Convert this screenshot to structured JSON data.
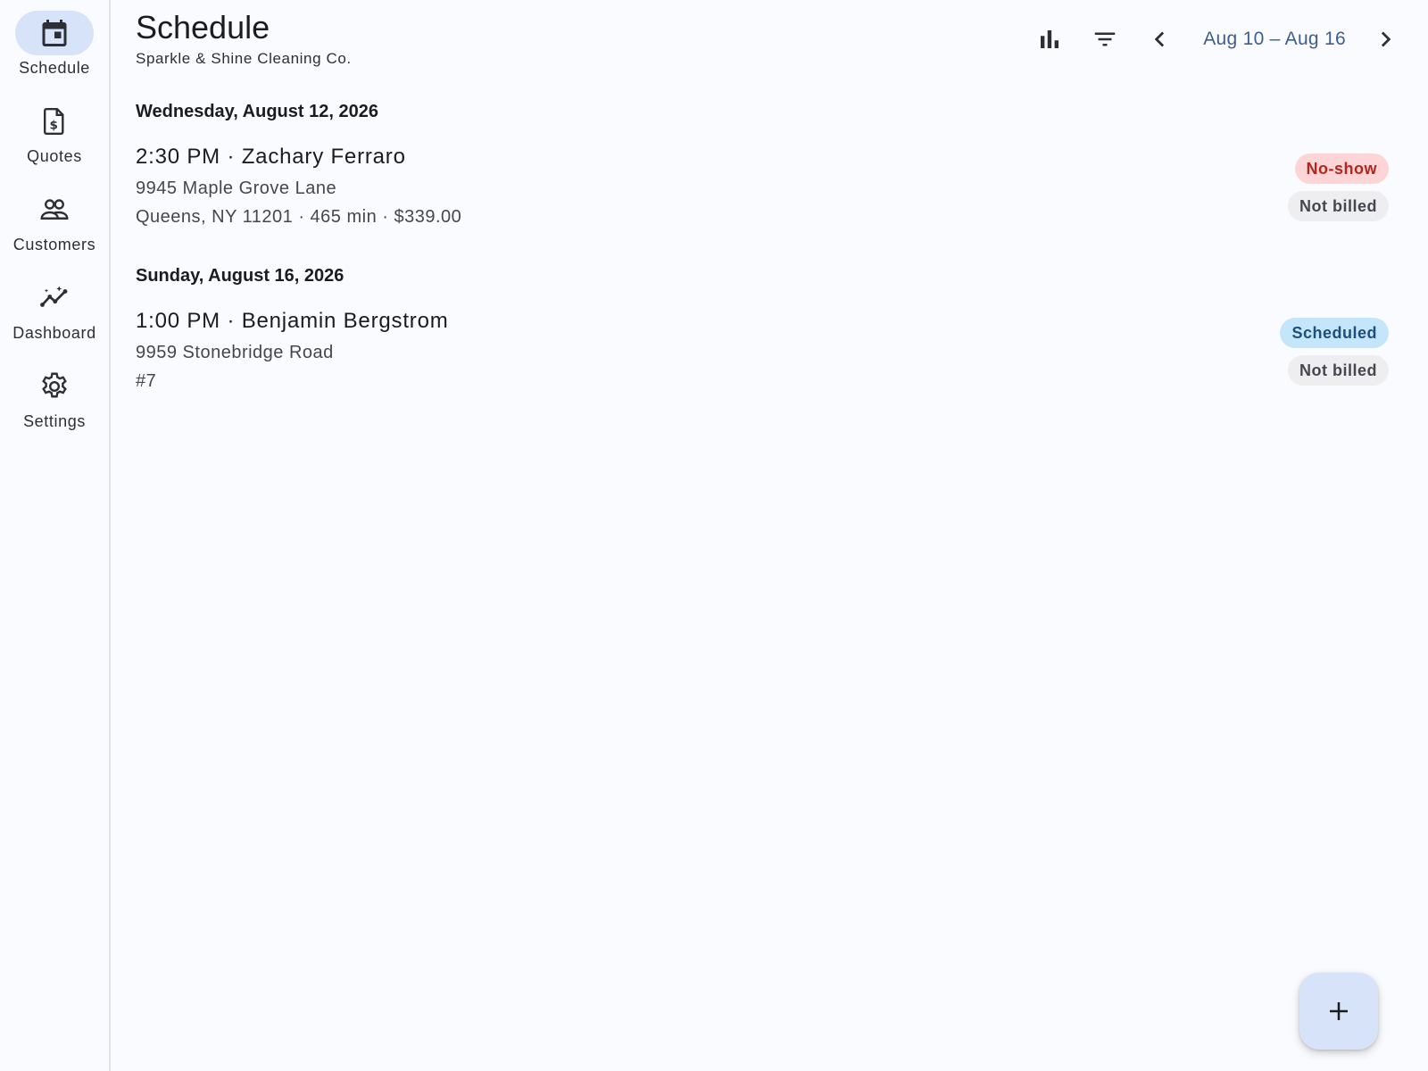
{
  "nav": {
    "items": [
      {
        "label": "Schedule",
        "icon": "calendar-icon",
        "active": true
      },
      {
        "label": "Quotes",
        "icon": "quote-document-icon",
        "active": false
      },
      {
        "label": "Customers",
        "icon": "people-icon",
        "active": false
      },
      {
        "label": "Dashboard",
        "icon": "insights-icon",
        "active": false
      },
      {
        "label": "Settings",
        "icon": "gear-icon",
        "active": false
      }
    ]
  },
  "header": {
    "title": "Schedule",
    "subtitle": "Sparkle & Shine Cleaning Co.",
    "week_range": "Aug 10 – Aug 16"
  },
  "days": [
    {
      "heading": "Wednesday, August 12, 2026",
      "appointments": [
        {
          "title": "2:30 PM · Zachary Ferraro",
          "line1": "9945 Maple Grove Lane",
          "line2": "Queens, NY 11201 · 465 min · $339.00",
          "status": "No-show",
          "billing": "Not billed"
        }
      ]
    },
    {
      "heading": "Sunday, August 16, 2026",
      "appointments": [
        {
          "title": "1:00 PM · Benjamin Bergstrom",
          "line1": "9959 Stonebridge Road",
          "line2": "#7",
          "status": "Scheduled",
          "billing": "Not billed"
        }
      ]
    }
  ],
  "colors": {
    "accent": "#d7e3f8",
    "range_text": "#3d5f8a",
    "noshow_bg": "#fdd5d6",
    "noshow_text": "#b3261e",
    "scheduled_bg": "#c5e5fb",
    "scheduled_text": "#1d4f7d",
    "notbilled_bg": "#eeeef1"
  }
}
